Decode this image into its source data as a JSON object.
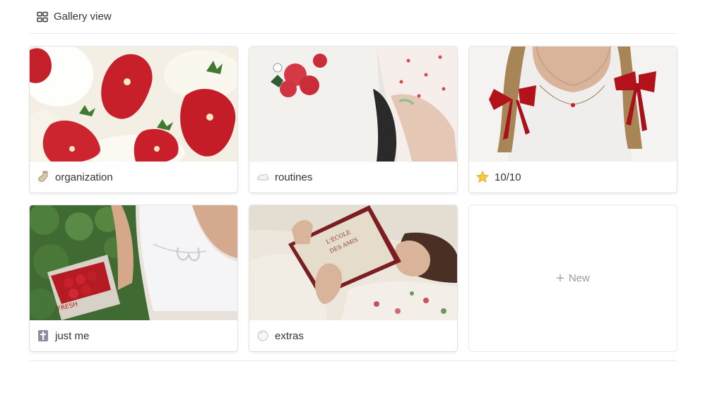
{
  "header": {
    "view_label": "Gallery view",
    "icon": "gallery-grid-icon"
  },
  "cards": [
    {
      "title": "organization",
      "icon": "sock-emoji-icon",
      "cover": "strawberries-and-cream-photo"
    },
    {
      "title": "routines",
      "icon": "cloud-emoji-icon",
      "cover": "strawberry-tshirt-photo"
    },
    {
      "title": "10/10",
      "icon": "star-emoji-icon",
      "cover": "red-bows-braids-photo"
    },
    {
      "title": "just me",
      "icon": "latin-cross-emoji-icon",
      "cover": "strawberry-picking-photo"
    },
    {
      "title": "extras",
      "icon": "bubble-emoji-icon",
      "cover": "reading-book-photo"
    }
  ],
  "new_card": {
    "label": "New",
    "icon": "plus-icon"
  },
  "colors": {
    "text": "#37352f",
    "muted": "#9b9a97",
    "border": "#e9e9e7",
    "strawberry_red": "#c8202b"
  }
}
